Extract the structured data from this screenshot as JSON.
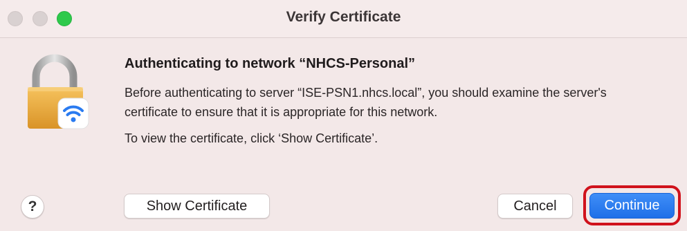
{
  "window": {
    "title": "Verify Certificate",
    "traffic_lights": [
      "close",
      "minimize",
      "zoom"
    ]
  },
  "dialog": {
    "icon": "lock-wifi-icon",
    "heading": "Authenticating to network “NHCS-Personal”",
    "body_line1": "Before authenticating to server “ISE-PSN1.nhcs.local”, you should examine the server's",
    "body_line2": "certificate to ensure that it is appropriate for this network.",
    "hint": "To view the certificate, click ‘Show Certificate’."
  },
  "buttons": {
    "help_label": "?",
    "show_certificate_label": "Show Certificate",
    "cancel_label": "Cancel",
    "continue_label": "Continue"
  },
  "colors": {
    "accent": "#2a7bf0",
    "highlight_ring": "#d0121c",
    "zoom_light": "#2ec94b"
  }
}
